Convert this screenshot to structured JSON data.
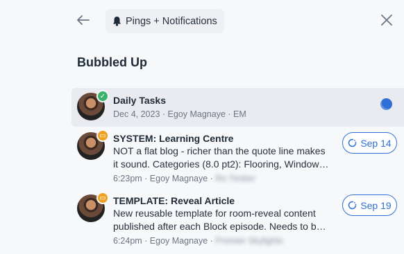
{
  "header": {
    "title": "Pings + Notifications",
    "back_icon": "arrow-left-icon",
    "bell_icon": "bell-icon",
    "close_icon": "close-icon"
  },
  "section": {
    "title": "Bubbled Up"
  },
  "items": [
    {
      "title": "Daily Tasks",
      "meta": "Dec 4, 2023 · Egoy Magnaye · EM",
      "badge": "check",
      "status": "in-progress-dot"
    },
    {
      "title": "SYSTEM: Learning Centre",
      "desc_line1": "NOT a flat blog - richer than the quote line makes",
      "desc_line2": "it sound. Categories (8.0 pt2): Flooring, Window…",
      "meta_time": "6:23pm · Egoy Magnaye ·",
      "meta_blurred": "Ro Timber",
      "badge": "message",
      "date_label": "Sep 14"
    },
    {
      "title": "TEMPLATE: Reveal Article",
      "desc_line1": "New reusable template for room-reveal content",
      "desc_line2": "published after each Block episode. Needs to b…",
      "meta_time": "6:24pm · Egoy Magnaye ·",
      "meta_blurred": "Premier Skylights",
      "badge": "message",
      "date_label": "Sep 19"
    }
  ],
  "colors": {
    "accent": "#2f6fd6",
    "check_badge": "#3bb26a",
    "message_badge": "#f0a020"
  }
}
